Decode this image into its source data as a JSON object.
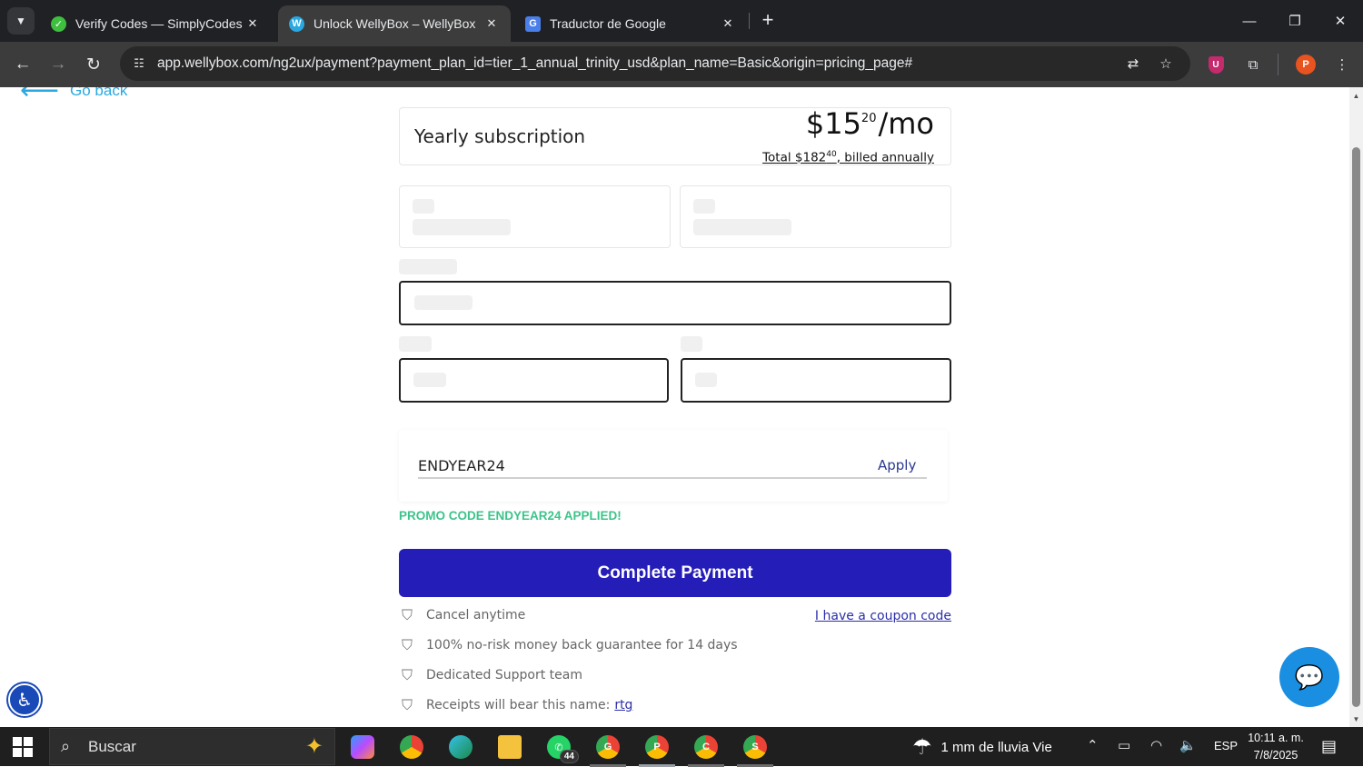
{
  "browser": {
    "tabs": [
      {
        "title": "Verify Codes — SimplyCodes",
        "favicon": "simplycodes-icon",
        "active": false
      },
      {
        "title": "Unlock WellyBox – WellyBox",
        "favicon": "wellybox-icon",
        "active": true
      },
      {
        "title": "Traductor de Google",
        "favicon": "google-translate-icon",
        "active": false
      }
    ],
    "url": "app.wellybox.com/ng2ux/payment?payment_plan_id=tier_1_annual_trinity_usd&plan_name=Basic&origin=pricing_page#",
    "profile_initial": "P",
    "extension_initial": "U"
  },
  "page": {
    "go_back": "Go back",
    "plan": {
      "name": "Yearly subscription",
      "price_currency": "$",
      "price_whole": "15",
      "price_cents": "20",
      "price_period": "/mo",
      "total_prefix": "Total $182",
      "total_cents": "40",
      "total_suffix": ", billed annually"
    },
    "promo": {
      "code_value": "ENDYEAR24",
      "apply_label": "Apply",
      "applied_message": "PROMO CODE ENDYEAR24 APPLIED!"
    },
    "pay_button": "Complete Payment",
    "coupon_link": "I have a coupon code",
    "features": [
      {
        "text": "Cancel anytime"
      },
      {
        "text": "100% no-risk money back guarantee for 14 days"
      },
      {
        "text": "Dedicated Support team"
      },
      {
        "text": "Receipts will bear this name:",
        "link": "rtg"
      }
    ]
  },
  "taskbar": {
    "search_placeholder": "Buscar",
    "whatsapp_badge": "44",
    "weather": "1 mm de lluvia Vie",
    "language": "ESP",
    "time": "10:11 a. m.",
    "date": "7/8/2025",
    "chrome_profiles": [
      "G",
      "P",
      "C",
      "S"
    ]
  },
  "colors": {
    "pay_button": "#251db8",
    "promo_success": "#3cc48a",
    "link": "#2b2fa8",
    "chat": "#1a8ee0"
  }
}
